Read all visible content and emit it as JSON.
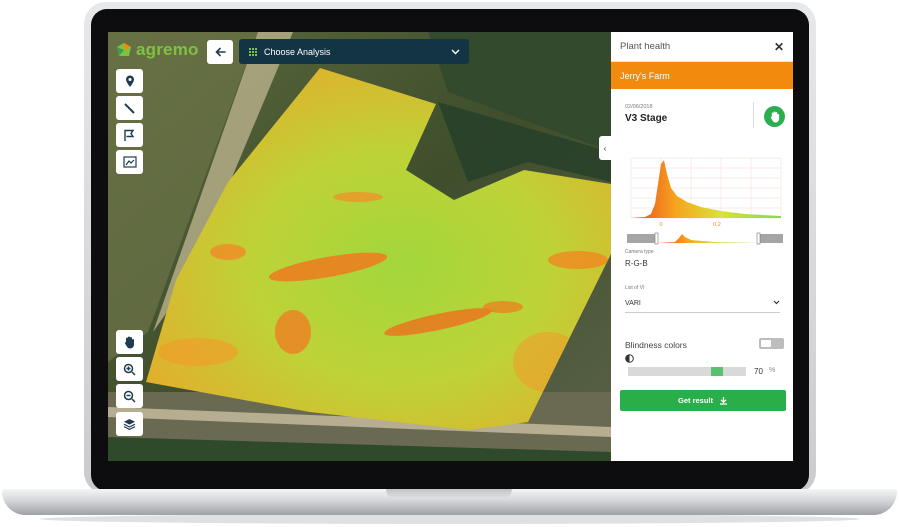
{
  "app": {
    "brand": "agremo"
  },
  "toolbar": {
    "back_icon": "arrow-left-icon",
    "analysis_label": "Choose Analysis"
  },
  "map_tools": [
    "location-pin-icon",
    "ruler-line-icon",
    "polygon-flag-icon",
    "area-scan-icon"
  ],
  "map_controls": [
    "hand-pan-icon",
    "zoom-in-icon",
    "zoom-out-icon",
    "layers-icon"
  ],
  "panel": {
    "title": "Plant health",
    "close": "✕",
    "farm": "Jerry's Farm",
    "date": "02/06/2018",
    "stage": "V3 Stage",
    "histogram": {
      "tick_0": "0",
      "tick_1": "0.2"
    },
    "camera_label": "Camera type",
    "camera_value": "R-G-B",
    "vi_label": "List of VI",
    "vi_value": "VARI",
    "blindness_label": "Blindness colors",
    "blindness_on": false,
    "opacity_value": "70",
    "opacity_unit": "%",
    "get_result": "Get result"
  },
  "colors": {
    "accent_orange": "#f28b0d",
    "accent_green": "#2aae4a",
    "header_dark": "#123445"
  }
}
